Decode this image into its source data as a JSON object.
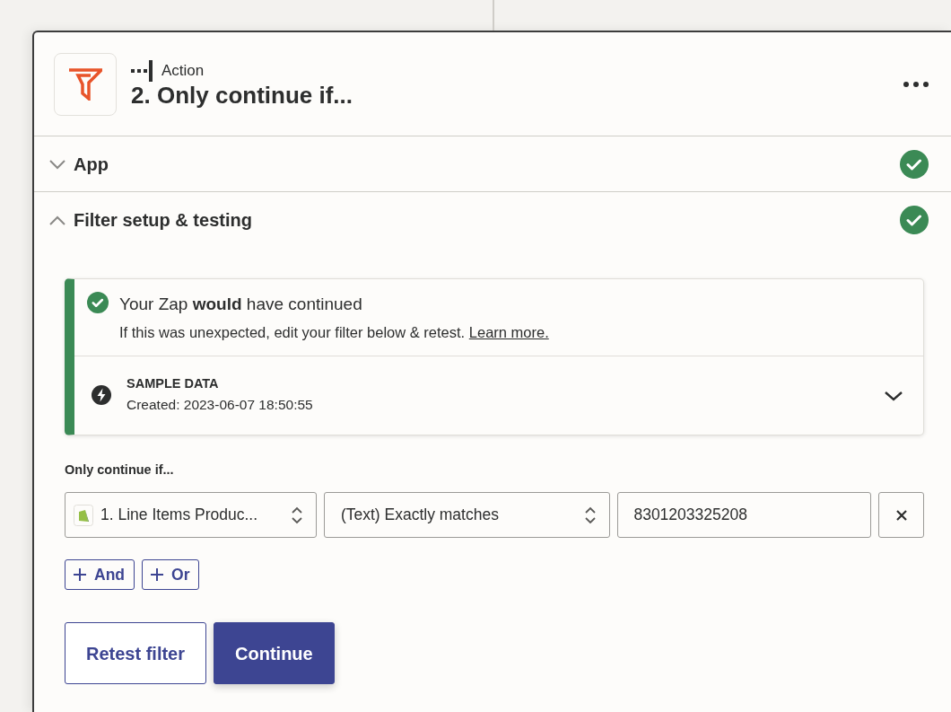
{
  "step": {
    "kind_label": "Action",
    "title": "2. Only continue if..."
  },
  "sections": [
    {
      "title": "App",
      "expanded": false,
      "complete": true
    },
    {
      "title": "Filter setup & testing",
      "expanded": true,
      "complete": true
    }
  ],
  "result": {
    "heading": "Your Zap **would** have continued",
    "message": "If this was unexpected, edit your filter below & retest.",
    "link": "Learn more.",
    "sample_title": "SAMPLE DATA",
    "sample_created": "Created: 2023-06-07 18:50:55"
  },
  "filter": {
    "label": "Only continue if...",
    "conditions": [
      {
        "field": "1. Line Items Produc...",
        "operator": "(Text) Exactly matches",
        "value": "8301203325208"
      }
    ],
    "add_buttons": [
      "And",
      "Or"
    ]
  },
  "buttons": [
    {
      "label": "Retest filter",
      "kind": "secondary"
    },
    {
      "label": "Continue",
      "kind": "primary"
    }
  ]
}
